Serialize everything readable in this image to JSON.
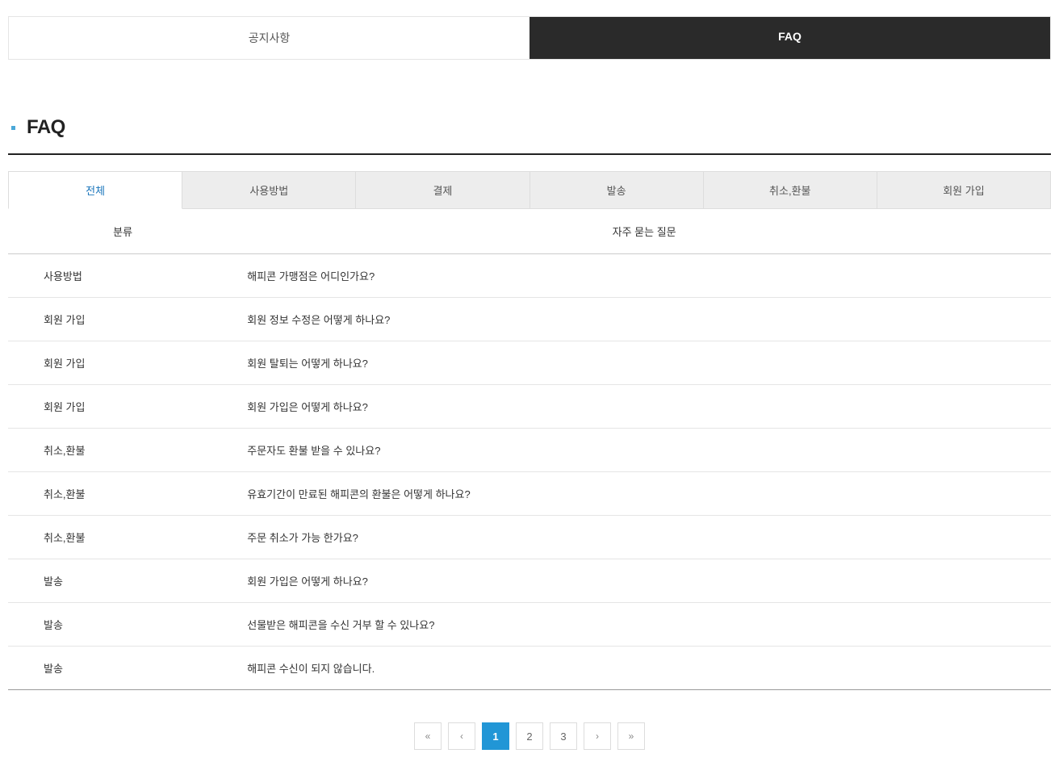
{
  "topTabs": [
    {
      "label": "공지사항",
      "active": false
    },
    {
      "label": "FAQ",
      "active": true
    }
  ],
  "pageTitle": "FAQ",
  "categoryTabs": [
    {
      "label": "전체",
      "active": true
    },
    {
      "label": "사용방법",
      "active": false
    },
    {
      "label": "결제",
      "active": false
    },
    {
      "label": "발송",
      "active": false
    },
    {
      "label": "취소,환불",
      "active": false
    },
    {
      "label": "회원 가입",
      "active": false
    }
  ],
  "tableHeaders": {
    "category": "분류",
    "question": "자주 묻는 질문"
  },
  "faqRows": [
    {
      "category": "사용방법",
      "question": "해피콘 가맹점은 어디인가요?"
    },
    {
      "category": "회원 가입",
      "question": "회원 정보 수정은 어떻게 하나요?"
    },
    {
      "category": "회원 가입",
      "question": "회원 탈퇴는 어떻게 하나요?"
    },
    {
      "category": "회원 가입",
      "question": "회원 가입은 어떻게 하나요?"
    },
    {
      "category": "취소,환불",
      "question": "주문자도 환불 받을 수 있나요?"
    },
    {
      "category": "취소,환불",
      "question": "유효기간이 만료된 해피콘의 환불은 어떻게 하나요?"
    },
    {
      "category": "취소,환불",
      "question": "주문 취소가 가능 한가요?"
    },
    {
      "category": "발송",
      "question": "회원 가입은 어떻게 하나요?"
    },
    {
      "category": "발송",
      "question": "선물받은 해피콘을 수신 거부 할 수 있나요?"
    },
    {
      "category": "발송",
      "question": "해피콘 수신이 되지 않습니다."
    }
  ],
  "pagination": {
    "first": "«",
    "prev": "‹",
    "pages": [
      {
        "label": "1",
        "active": true
      },
      {
        "label": "2",
        "active": false
      },
      {
        "label": "3",
        "active": false
      }
    ],
    "next": "›",
    "last": "»"
  }
}
